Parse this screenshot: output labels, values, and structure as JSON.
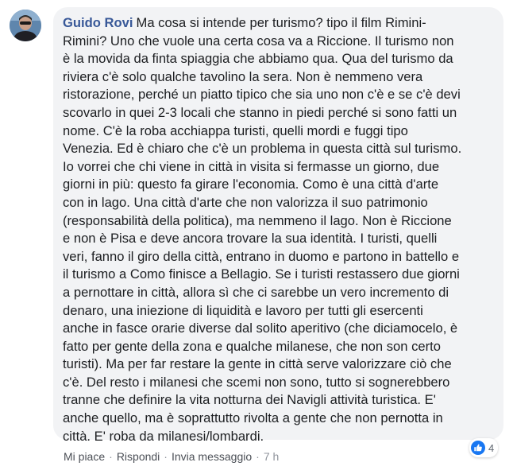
{
  "comment": {
    "author": "Guido Rovi",
    "lines": [
      "Ma cosa si intende per turismo? tipo il film Rimini-",
      "Rimini? Uno che vuole una certa cosa va a Riccione. Il turismo non",
      "è la movida da finta spiaggia che abbiamo qua. Qua del turismo da",
      "riviera c'è solo qualche tavolino la sera. Non è nemmeno vera",
      "ristorazione, perché un piatto tipico che sia uno non c'è e se c'è devi",
      "scovarlo in quei 2-3 locali che stanno in piedi perché si sono fatti un",
      "nome. C'è la roba acchiappa turisti, quelli mordi e fuggi tipo",
      "Venezia. Ed è chiaro che c'è un problema in questa città sul turismo.",
      "Io vorrei che chi viene in città in visita si fermasse un giorno, due",
      "giorni in più: questo fa girare l'economia. Como è una città d'arte",
      "con in lago. Una città d'arte che non valorizza il suo patrimonio",
      "(responsabilità della politica), ma nemmeno il lago. Non è Riccione",
      "e non è Pisa e deve ancora trovare la sua identità. I turisti, quelli",
      "veri, fanno il giro della città, entrano in duomo e partono in battello e",
      "il turismo a Como finisce a Bellagio. Se i turisti restassero due giorni",
      "a pernottare in città, allora sì che ci sarebbe un vero incremento di",
      "denaro, una iniezione di liquidità e lavoro per tutti gli esercenti",
      "anche in fasce orarie diverse dal solito aperitivo (che diciamocelo, è",
      "fatto per gente della zona e qualche milanese, che non son certo",
      "turisti). Ma per far restare la gente in città serve valorizzare ciò che",
      "c'è. Del resto i milanesi che scemi non sono, tutto si sognerebbero",
      "tranne che definire la vita notturna dei Navigli attività turistica. E'",
      "anche quello, ma è soprattutto rivolta a gente che non pernotta in",
      "città. E' roba da milanesi/lombardi."
    ],
    "reactions": {
      "count": "4",
      "icon": "like-thumb-icon",
      "color": "#1877f2"
    }
  },
  "actions": {
    "like": "Mi piace",
    "reply": "Rispondi",
    "message": "Invia messaggio",
    "separator": "·",
    "time": "7 h"
  },
  "colors": {
    "author": "#385898",
    "bubble": "#f2f3f5",
    "text": "#1c1e21",
    "meta": "#606770"
  }
}
